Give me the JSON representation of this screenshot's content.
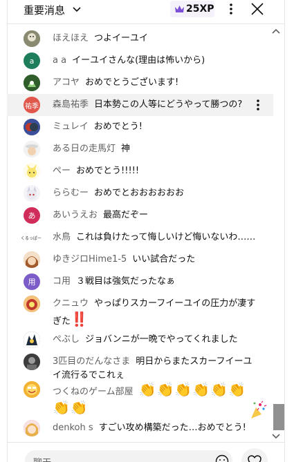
{
  "header": {
    "title": "重要消息",
    "xp_label": "25XP",
    "accent_color": "#7b4fd6"
  },
  "messages": [
    {
      "author": "ほえほえ",
      "text": "つよイーユイ",
      "avatar": {
        "kind": "photo",
        "color": "#6b6b4f"
      }
    },
    {
      "author": "a a",
      "text": "イーユイさんな(理由は怖いから)",
      "avatar": {
        "kind": "letter",
        "letter": "a",
        "color": "#1e7d5a"
      }
    },
    {
      "author": "アコヤ",
      "text": "おめでとうございます!",
      "avatar": {
        "kind": "photo",
        "color": "#2f5d2b"
      }
    },
    {
      "author": "森島祐季",
      "text": "日本勢この人等にどうやって勝つの?",
      "avatar": {
        "kind": "letter",
        "letter": "祐季",
        "color": "#e2574c"
      }
    },
    {
      "author": "ミュレイ",
      "text": "おめでとう!",
      "avatar": {
        "kind": "photo",
        "color": "#3b4f9a"
      }
    },
    {
      "author": "ある日の走馬灯",
      "text": "神",
      "avatar": {
        "kind": "photo",
        "color": "#d9d9d9"
      }
    },
    {
      "author": "ぺー",
      "text": "おめでとう!!!!!",
      "avatar": {
        "kind": "photo",
        "color": "#f4e27a"
      }
    },
    {
      "author": "ららむー",
      "text": "おめでとおおおおおお",
      "avatar": {
        "kind": "photo",
        "color": "#cfcfe0"
      }
    },
    {
      "author": "あいうえお",
      "text": "最高だぞー",
      "avatar": {
        "kind": "letter",
        "letter": "あ",
        "color": "#d12d5a"
      }
    },
    {
      "author": "水鳥",
      "text": "これは負けたって悔しいけど悔いないわ……",
      "avatar": {
        "kind": "wordmark",
        "letter": "くるっぱー",
        "color": "#ffffff"
      }
    },
    {
      "author": "ゆきジロHime1-5",
      "text": "いい試合だった",
      "avatar": {
        "kind": "photo",
        "color": "#c98b5e"
      }
    },
    {
      "author": "コ用",
      "text": "３戦目は強気だったなぁ",
      "avatar": {
        "kind": "letter",
        "letter": "用",
        "color": "#7c5cc9"
      }
    },
    {
      "author": "クニュウ",
      "text": "やっぱりスカーフイーユイの圧力が凄すぎた",
      "tail": "‼️",
      "avatar": {
        "kind": "photo",
        "color": "#b5652a"
      }
    },
    {
      "author": "ぺぶし",
      "text": "ジョバンニが一晩でやってくれました",
      "avatar": {
        "kind": "photo",
        "color": "#2a2a2a"
      }
    },
    {
      "author": "3匹目のだんなさま",
      "text": "明日からまたスカーフイーユイ流行るでこれぇ",
      "avatar": {
        "kind": "photo",
        "color": "#3d3d3d"
      }
    },
    {
      "author": "つくねのゲーム部屋",
      "text": "",
      "emoji_line1": "👏👏👏👏👏👏",
      "emoji_line2": "👏👏",
      "avatar": {
        "kind": "photo",
        "color": "#f2b233"
      }
    },
    {
      "author": "denkoh s",
      "text": "すごい攻め構築だった…おめでとう!",
      "avatar": {
        "kind": "photo",
        "color": "#c98f8f"
      }
    }
  ],
  "input": {
    "placeholder": "聊天..."
  }
}
